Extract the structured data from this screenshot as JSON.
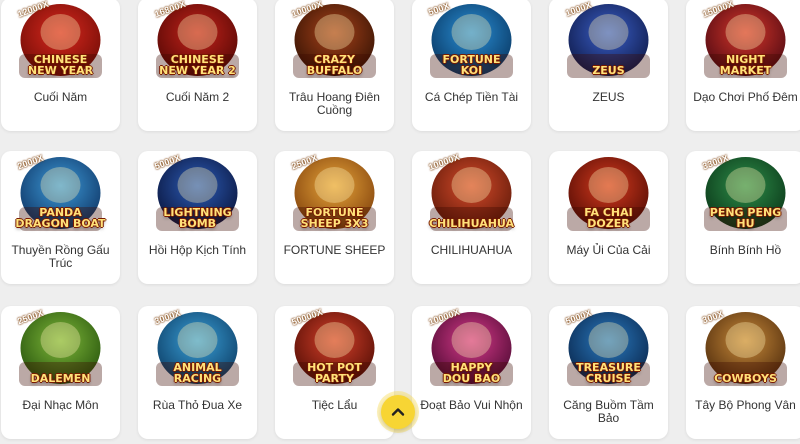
{
  "games": [
    {
      "label": "Cuối Năm",
      "logo": "Chinese\nNew Year",
      "multiplier": "12000X",
      "icon": "lion-dance-icon",
      "bg": "#d9281e",
      "bg2": "#7a0f08"
    },
    {
      "label": "Cuối Năm 2",
      "logo": "Chinese\nNew Year 2",
      "multiplier": "16800X",
      "icon": "lion-dance-icon",
      "bg": "#c4231b",
      "bg2": "#5e0a06"
    },
    {
      "label": "Trâu Hoang Điên Cuồng",
      "logo": "Crazy\nBuffalo",
      "multiplier": "10000X",
      "icon": "buffalo-icon",
      "bg": "#a8421a",
      "bg2": "#3d1605"
    },
    {
      "label": "Cá Chép Tiền Tài",
      "logo": "Fortune\nKoi",
      "multiplier": "500X",
      "icon": "koi-fish-icon",
      "bg": "#2a8fd6",
      "bg2": "#0b3e6b"
    },
    {
      "label": "ZEUS",
      "logo": "Zeus",
      "multiplier": "1000X",
      "icon": "zeus-icon",
      "bg": "#3a5fc8",
      "bg2": "#121f52"
    },
    {
      "label": "Dạo Chơi Phố Đêm",
      "logo": "Night\nMarket",
      "multiplier": "15000X",
      "icon": "lantern-icon",
      "bg": "#d6362a",
      "bg2": "#5a0d14"
    },
    {
      "label": "Thuyền Rồng Gấu Trúc",
      "logo": "Panda\nDragon Boat",
      "multiplier": "2000X",
      "icon": "panda-icon",
      "bg": "#3d9ad8",
      "bg2": "#123d6e"
    },
    {
      "label": "Hồi Hộp Kịch Tính",
      "logo": "Lightning\nBomb",
      "multiplier": "5000X",
      "icon": "lightning-bomb-icon",
      "bg": "#2d5db8",
      "bg2": "#0c1a45"
    },
    {
      "label": "FORTUNE SHEEP",
      "logo": "Fortune\nSheep 3x3",
      "multiplier": "2500X",
      "icon": "sheep-icon",
      "bg": "#e8a53a",
      "bg2": "#8a4a10"
    },
    {
      "label": "CHILIHUAHUA",
      "logo": "Chilihuahua",
      "multiplier": "10000X",
      "icon": "chihuahua-icon",
      "bg": "#d64a2a",
      "bg2": "#6a1e0c"
    },
    {
      "label": "Máy Ủi Của Cải",
      "logo": "Fa Chai\nDozer",
      "multiplier": "",
      "icon": "gold-ingot-icon",
      "bg": "#d63a1e",
      "bg2": "#5e1006"
    },
    {
      "label": "Bính Bính Hồ",
      "logo": "Peng Peng\nHu",
      "multiplier": "3300X",
      "icon": "mahjong-tile-icon",
      "bg": "#2e8f4a",
      "bg2": "#0d3d1c"
    },
    {
      "label": "Đại Nhạc Môn",
      "logo": "Dalemen",
      "multiplier": "2500X",
      "icon": "elephant-icon",
      "bg": "#7fb83a",
      "bg2": "#2e5c10"
    },
    {
      "label": "Rùa Thỏ Đua Xe",
      "logo": "Animal\nRacing",
      "multiplier": "3000X",
      "icon": "rabbit-racer-icon",
      "bg": "#3aa0d8",
      "bg2": "#10456e"
    },
    {
      "label": "Tiệc Lẩu",
      "logo": "Hot Pot\nParty",
      "multiplier": "50000X",
      "icon": "hot-pot-icon",
      "bg": "#d6402a",
      "bg2": "#5e1208"
    },
    {
      "label": "Đoạt Bảo Vui Nhộn",
      "logo": "Happy\nDou Bao",
      "multiplier": "10000X",
      "icon": "gumball-machine-icon",
      "bg": "#d63a8a",
      "bg2": "#5a0e3a"
    },
    {
      "label": "Căng Buồm Tầm Bảo",
      "logo": "Treasure\nCruise",
      "multiplier": "5000X",
      "icon": "pirate-icon",
      "bg": "#2a7ac0",
      "bg2": "#0c2d55"
    },
    {
      "label": "Tây Bộ Phong Vân",
      "logo": "Cowboys",
      "multiplier": "300X",
      "icon": "cowboy-icon",
      "bg": "#c88a3a",
      "bg2": "#5a3410"
    }
  ],
  "scroll_top": {
    "icon": "chevron-up-icon",
    "color": "#f7d534"
  }
}
